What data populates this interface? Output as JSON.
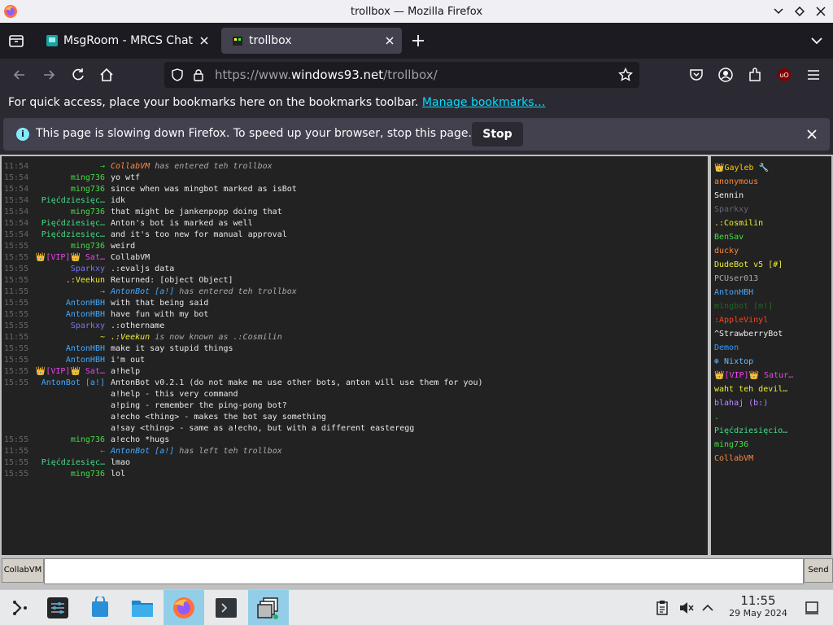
{
  "window": {
    "title": "trollbox — Mozilla Firefox"
  },
  "tabs": [
    {
      "label": "MsgRoom - MRCS Chat"
    },
    {
      "label": "trollbox"
    }
  ],
  "url": {
    "prefix": "https://www.",
    "domain": "windows93.net",
    "path": "/trollbox/"
  },
  "bookmarks_bar": {
    "text": "For quick access, place your bookmarks here on the bookmarks toolbar.",
    "link": "Manage bookmarks…"
  },
  "notification": {
    "message": "This page is slowing down Firefox. To speed up your browser, stop this page.",
    "stop_label": "Stop"
  },
  "chat": {
    "rows": [
      {
        "ts": "11:54",
        "nick": "→",
        "nick_color": "#33cc33",
        "system": true,
        "who": "CollabVM",
        "who_color": "#ff8844",
        "msg": " has entered teh trollbox"
      },
      {
        "ts": "15:54",
        "nick": "ming736",
        "nick_color": "#44dd44",
        "msg": "yo wtf"
      },
      {
        "ts": "15:54",
        "nick": "ming736",
        "nick_color": "#44dd44",
        "msg": "since when was mingbot marked as isBot"
      },
      {
        "ts": "15:54",
        "nick": "Pięćdziesięc…",
        "nick_color": "#44dd88",
        "msg": "idk"
      },
      {
        "ts": "15:54",
        "nick": "ming736",
        "nick_color": "#44dd44",
        "msg": "that might be jankenpopp doing that"
      },
      {
        "ts": "15:54",
        "nick": "Pięćdziesięc…",
        "nick_color": "#44dd88",
        "msg": "Anton's bot is marked as well"
      },
      {
        "ts": "15:54",
        "nick": "Pięćdziesięc…",
        "nick_color": "#44dd88",
        "msg": "and it's too new for manual approval"
      },
      {
        "ts": "15:55",
        "nick": "ming736",
        "nick_color": "#44dd44",
        "msg": "weird"
      },
      {
        "ts": "15:55",
        "nick": "👑[VIP]👑 Sat…",
        "nick_color": "#ee44ee",
        "msg": "CollabVM"
      },
      {
        "ts": "15:55",
        "nick": "Sparkxy",
        "nick_color": "#7777ee",
        "msg": ".:evaljs data"
      },
      {
        "ts": "15:55",
        "nick": ".:Veekun",
        "nick_color": "#eeee33",
        "msg": "Returned: [object Object]"
      },
      {
        "ts": "11:55",
        "nick": "→",
        "nick_color": "#33cc33",
        "system": true,
        "who": "AntonBot [a!]",
        "who_color": "#44aaff",
        "msg": " has entered teh trollbox"
      },
      {
        "ts": "15:55",
        "nick": "AntonHBH",
        "nick_color": "#44aaff",
        "msg": "with that being said"
      },
      {
        "ts": "15:55",
        "nick": "AntonHBH",
        "nick_color": "#44aaff",
        "msg": "have fun with my bot"
      },
      {
        "ts": "15:55",
        "nick": "Sparkxy",
        "nick_color": "#7777ee",
        "msg": ".:othername"
      },
      {
        "ts": "11:55",
        "nick": "~",
        "nick_color": "#eeee33",
        "system": true,
        "who": ".:Veekun",
        "who_color": "#eeee33",
        "msg": " is now known as .:Cosmilin"
      },
      {
        "ts": "15:55",
        "nick": "AntonHBH",
        "nick_color": "#44aaff",
        "msg": "make it say stupid things"
      },
      {
        "ts": "15:55",
        "nick": "AntonHBH",
        "nick_color": "#44aaff",
        "msg": "i'm out"
      },
      {
        "ts": "15:55",
        "nick": "👑[VIP]👑 Sat…",
        "nick_color": "#ee44ee",
        "msg": "a!help"
      },
      {
        "ts": "15:55",
        "nick": "AntonBot [a!]",
        "nick_color": "#44aaff",
        "msg": "AntonBot v0.2.1 (do not make me use other bots, anton will use them for you)"
      },
      {
        "ts": "",
        "nick": "",
        "nick_color": "#44aaff",
        "msg": "a!help - this very command"
      },
      {
        "ts": "",
        "nick": "",
        "nick_color": "#44aaff",
        "msg": "a!ping - remember the ping-pong bot?"
      },
      {
        "ts": "",
        "nick": "",
        "nick_color": "#44aaff",
        "msg": "a!echo <thing> - makes the bot say something"
      },
      {
        "ts": "",
        "nick": "",
        "nick_color": "#44aaff",
        "msg": "a!say <thing> - same as a!echo, but with a different easteregg"
      },
      {
        "ts": "15:55",
        "nick": "ming736",
        "nick_color": "#44dd44",
        "msg": "a!echo *hugs"
      },
      {
        "ts": "11:55",
        "nick": "←",
        "nick_color": "#ff3333",
        "system": true,
        "who": "AntonBot [a!]",
        "who_color": "#44aaff",
        "msg": " has left teh trollbox"
      },
      {
        "ts": "15:55",
        "nick": "Pięćdziesięc…",
        "nick_color": "#44dd88",
        "msg": "lmao"
      },
      {
        "ts": "15:55",
        "nick": "ming736",
        "nick_color": "#44dd44",
        "msg": "lol"
      }
    ]
  },
  "users": [
    {
      "name": "👑Gayleb 🔧",
      "color": "#ffcc00"
    },
    {
      "name": "anonymous",
      "color": "#ff8833"
    },
    {
      "name": "Sennin",
      "color": "#eeeeee"
    },
    {
      "name": "Sparkxy",
      "color": "#666677"
    },
    {
      "name": ".:Cosmilin",
      "color": "#eeee33"
    },
    {
      "name": "BenSav",
      "color": "#44dd44"
    },
    {
      "name": "ducky",
      "color": "#ff8833"
    },
    {
      "name": "DudeBot v5 [#]",
      "color": "#eeee33"
    },
    {
      "name": "PCUser013",
      "color": "#aaaaaa"
    },
    {
      "name": "AntonHBH",
      "color": "#44aaff"
    },
    {
      "name": "mingbot [m!]",
      "color": "#226622"
    },
    {
      "name": ":AppleVinyl",
      "color": "#ff4422"
    },
    {
      "name": "^StrawberryBot",
      "color": "#eeeeee"
    },
    {
      "name": "Demon",
      "color": "#3399ff"
    },
    {
      "name": "❄ Nixtop",
      "color": "#66bbff"
    },
    {
      "name": "👑[VIP]👑 Satur…",
      "color": "#ee44ee"
    },
    {
      "name": "waht teh devil…",
      "color": "#eeee33"
    },
    {
      "name": "blahaj (b:)",
      "color": "#bb88ff"
    },
    {
      "name": ".",
      "color": "#44dd44"
    },
    {
      "name": "Pięćdziesięcio…",
      "color": "#44dd88"
    },
    {
      "name": "ming736",
      "color": "#44dd44"
    },
    {
      "name": "CollabVM",
      "color": "#ff8844"
    }
  ],
  "input": {
    "name_button": "CollabVM",
    "send_label": "Send"
  },
  "taskbar": {
    "time": "11:55",
    "date": "29 May 2024"
  }
}
